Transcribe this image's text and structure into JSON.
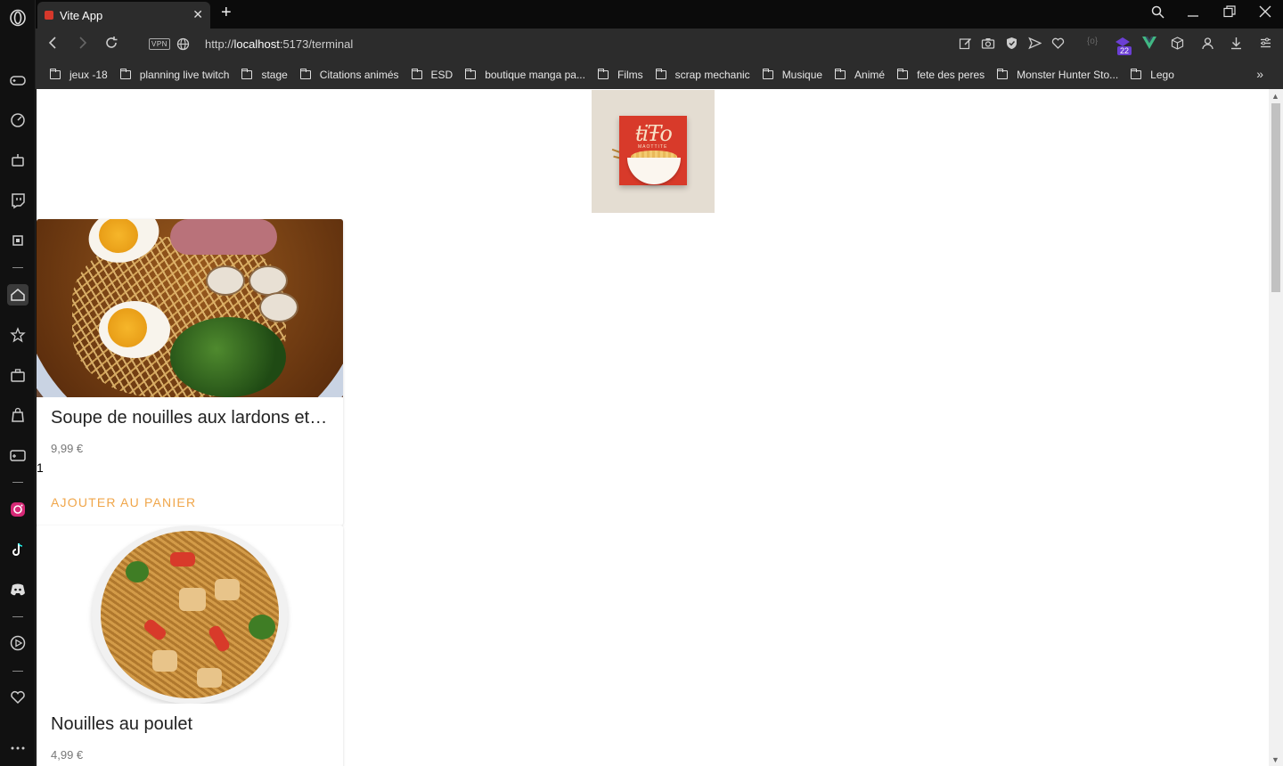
{
  "browser": {
    "tab_title": "Vite App",
    "tab_close": "✕",
    "new_tab": "+",
    "url_prefix": "http://",
    "url_host": "localhost",
    "url_path": ":5173/terminal",
    "vpn_label": "VPN",
    "extension_badge": "22",
    "bookmarks": [
      "jeux -18",
      "planning live twitch",
      "stage",
      "Citations animés",
      "ESD",
      "boutique manga pa...",
      "Films",
      "scrap mechanic",
      "Musique",
      "Animé",
      "fete des peres",
      "Monster Hunter Sto...",
      "Lego"
    ],
    "bookmarks_more": "»"
  },
  "logo": {
    "text": "ŧiŦo",
    "subtext": "MAOTTITE"
  },
  "products": [
    {
      "title": "Soupe de nouilles aux lardons et champignons",
      "price": "9,99 €",
      "quantity": "1",
      "button": "Ajouter au panier"
    },
    {
      "title": "Nouilles au poulet",
      "price": "4,99 €"
    }
  ],
  "colors": {
    "accent": "#f0a64a",
    "chrome": "#2c2c2c",
    "tab_active": "#2c2c2c"
  }
}
